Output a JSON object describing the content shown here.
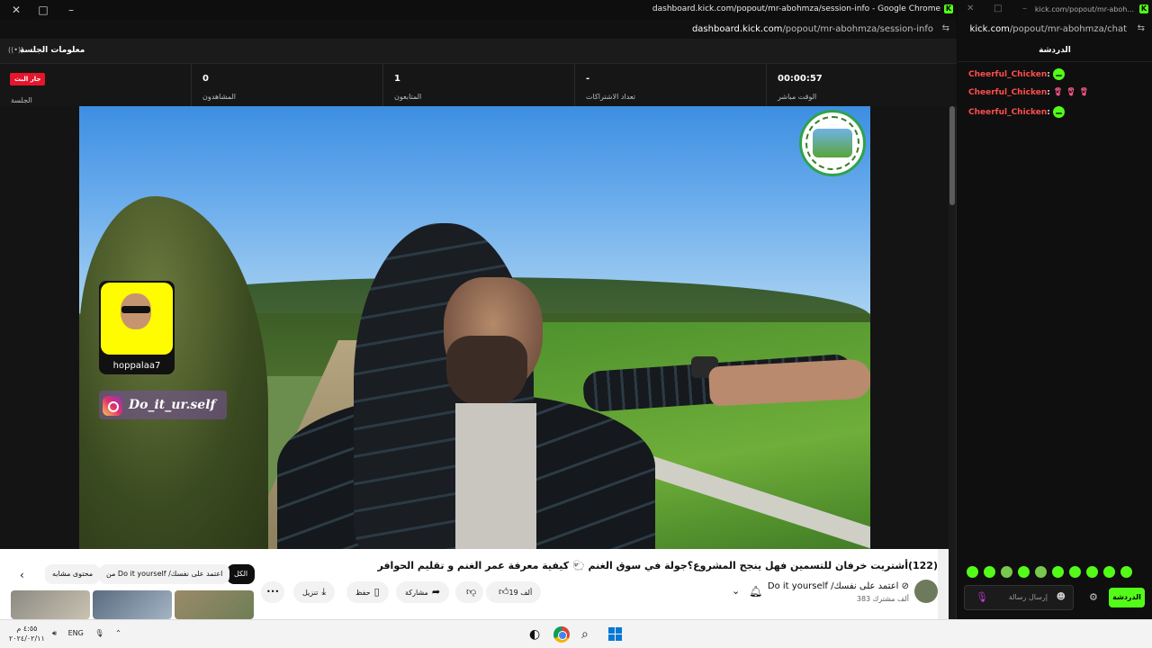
{
  "left_window": {
    "title": "dashboard.kick.com/popout/mr-abohmza/session-info - Google Chrome",
    "url_host": "dashboard.kick.com",
    "url_path": "/popout/mr-abohmza/session-info",
    "session_title": "معلومات الجلسة",
    "stats": [
      {
        "value": "",
        "label": "الجلسة",
        "badge": "جار البث"
      },
      {
        "value": "0",
        "label": "المشاهدون"
      },
      {
        "value": "1",
        "label": "المتابعون"
      },
      {
        "value": "-",
        "label": "تعداد الاشتراكات"
      },
      {
        "value": "00:00:57",
        "label": "الوقت مباشر"
      }
    ],
    "overlay": {
      "snap_name": "hoppalaa7",
      "instagram": "Do_it_ur.self"
    }
  },
  "youtube": {
    "title": "(122)أشتريت خرفان للتسمين فهل ينجح المشروع؟جولة في سوق الغنم 🐑 كيفية معرفة عمر الغنم و تقليم الحوافر",
    "channel_name": "Do it yourself /اعتمد على نفسك ⊘",
    "subs": "383 ألف مشترك",
    "like_count": "19 ألف",
    "share_label": "مشاركة",
    "save_label": "حفظ",
    "download_label": "تنزيل",
    "more_label": "•••",
    "chips": [
      {
        "label": "الكل",
        "active": true
      },
      {
        "label": "من Do it yourself /اعتمد على نفسك"
      },
      {
        "label": "محتوى مشابه"
      }
    ]
  },
  "right_window": {
    "title": "kick.com/popout/mr-aboh...",
    "url_host": "kick.com",
    "url_path": "/popout/mr-abohmza/chat",
    "chat_header": "الدردشة",
    "messages": [
      {
        "user": "Cheerful_Chicken",
        "content": "emote"
      },
      {
        "user": "Cheerful_Chicken",
        "content": "roses"
      },
      {
        "user": "Cheerful_Chicken",
        "content": "emote"
      }
    ],
    "input_placeholder": "إرسال رسالة",
    "send_label": "الدردشة"
  },
  "taskbar": {
    "time": "٤:٥٥ م",
    "date": "٢٠٢٤/٠٢/١١",
    "lang": "ENG"
  }
}
